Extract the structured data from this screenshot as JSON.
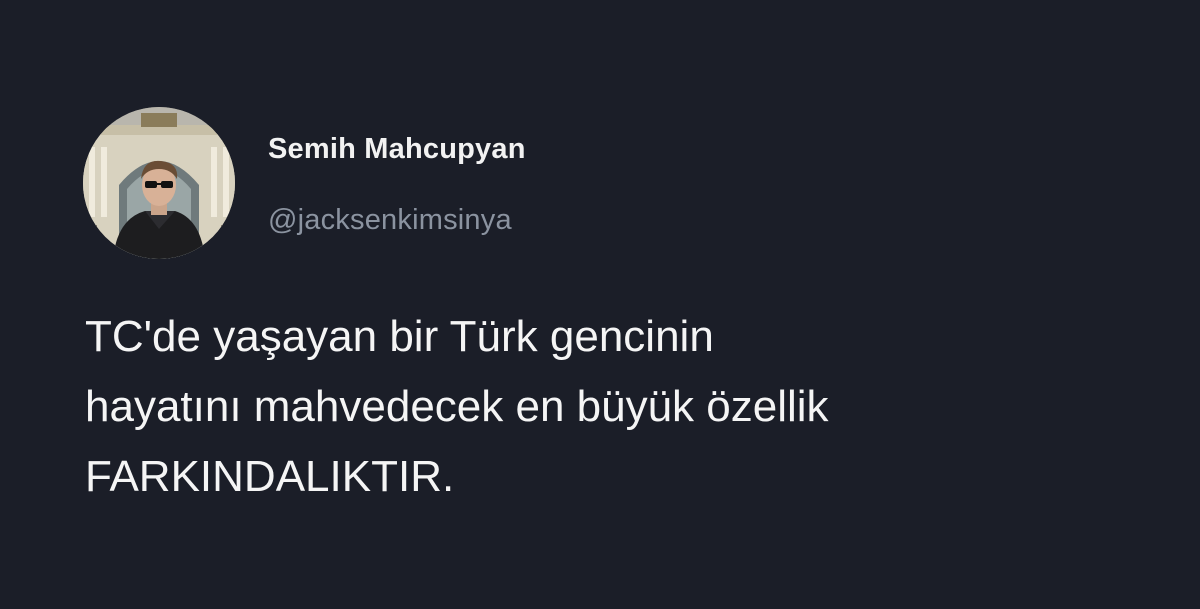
{
  "tweet": {
    "author": {
      "display_name": "Semih Mahcupyan",
      "handle": "@jacksenkimsinya",
      "avatar_icon": "profile-photo"
    },
    "text_lines": [
      "TC'de yaşayan bir Türk gencinin",
      "hayatını mahvedecek en büyük özellik",
      "FARKINDALIKTIR."
    ]
  },
  "colors": {
    "background": "#1b1e28",
    "name_text": "#f2f2f2",
    "handle_text": "#8b93a0",
    "body_text": "#f5f5f5"
  }
}
